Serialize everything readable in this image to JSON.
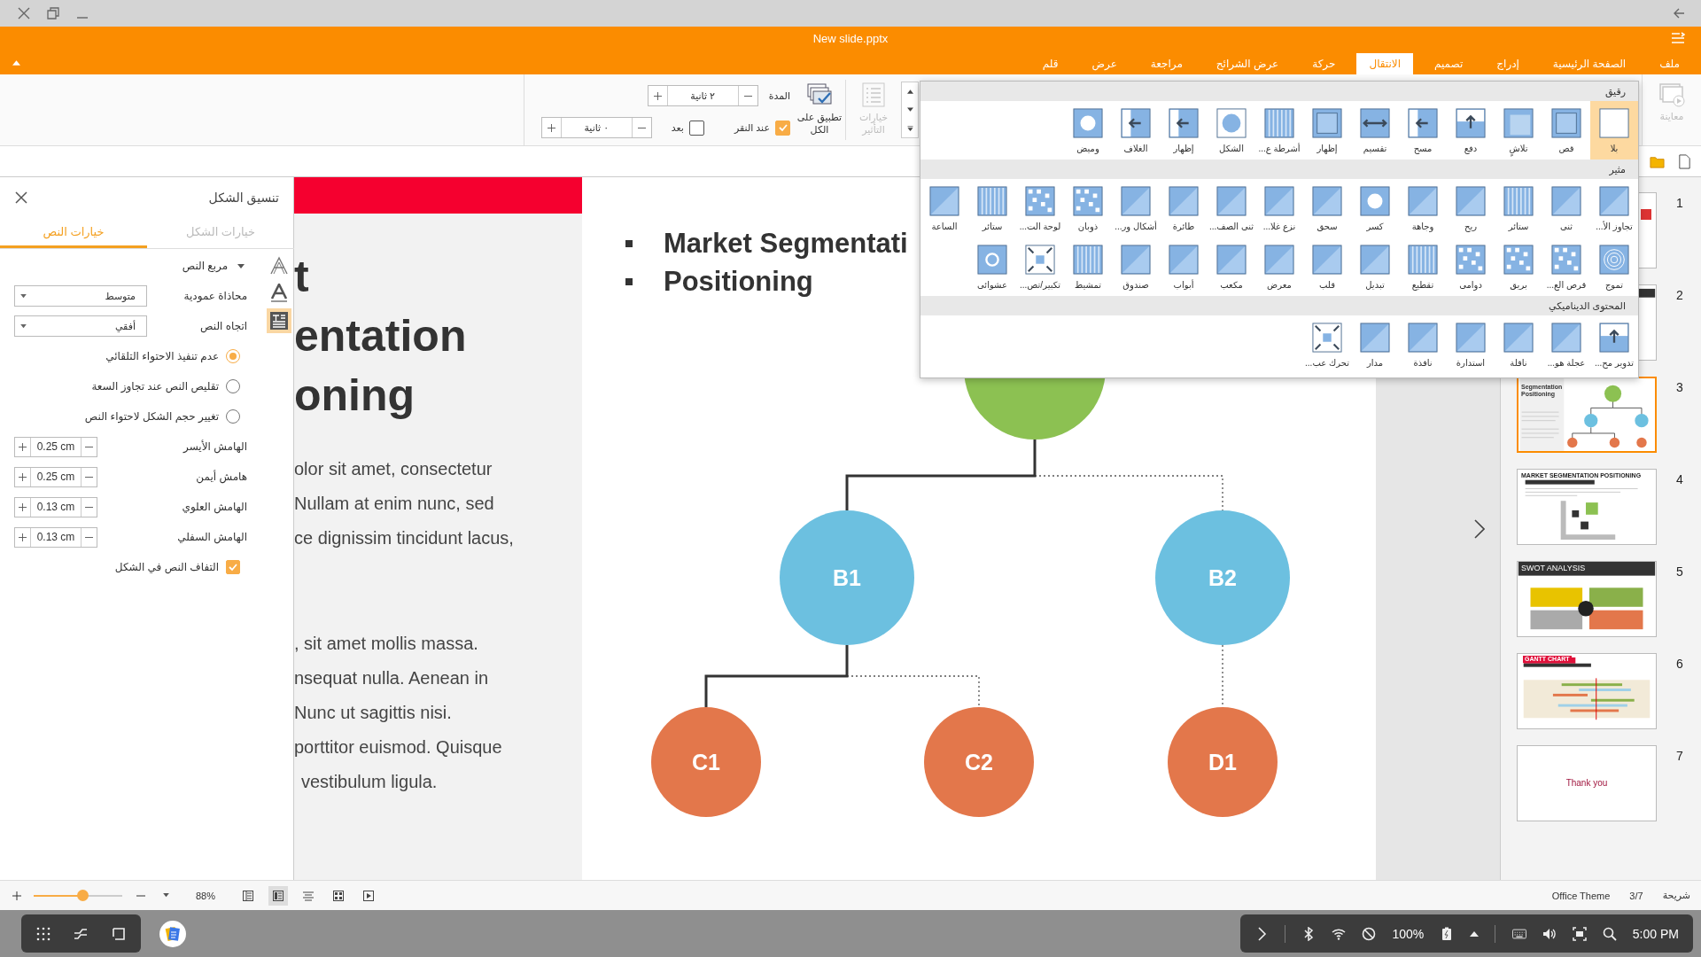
{
  "window": {
    "title": "New slide.pptx"
  },
  "menu_tabs": [
    {
      "label": "ملف",
      "selected": false
    },
    {
      "label": "الصفحة الرئيسية",
      "selected": false
    },
    {
      "label": "إدراج",
      "selected": false
    },
    {
      "label": "تصميم",
      "selected": false
    },
    {
      "label": "الانتقال",
      "selected": true
    },
    {
      "label": "حركة",
      "selected": false
    },
    {
      "label": "عرض الشرائح",
      "selected": false
    },
    {
      "label": "مراجعة",
      "selected": false
    },
    {
      "label": "عرض",
      "selected": false
    },
    {
      "label": "قلم",
      "selected": false
    }
  ],
  "ribbon": {
    "preview": {
      "label": "معاينة",
      "disabled": true
    },
    "effect_options": {
      "label": "خيارات التأثير",
      "disabled": true
    },
    "apply_all": {
      "label": "تطبيق على الكل"
    },
    "duration": {
      "label": "المدة",
      "value": "٢ ثانية"
    },
    "on_click": {
      "label": "عند النقر",
      "checked": true
    },
    "after": {
      "label": "بعد",
      "checked": false,
      "value": "٠ ثانية"
    }
  },
  "gallery": {
    "sections": [
      {
        "title": "رقيق",
        "items": [
          {
            "label": "بلا",
            "selected": true
          },
          {
            "label": "قص",
            "selected": false
          },
          {
            "label": "تلاشٍ",
            "selected": false
          },
          {
            "label": "دفع",
            "selected": false
          },
          {
            "label": "مسح",
            "selected": false
          },
          {
            "label": "تقسيم",
            "selected": false
          },
          {
            "label": "إظهار",
            "selected": false
          },
          {
            "label": "أشرطة ع...",
            "selected": false
          },
          {
            "label": "الشكل",
            "selected": false
          },
          {
            "label": "إظهار",
            "selected": false
          },
          {
            "label": "الغلاف",
            "selected": false
          },
          {
            "label": "وميض",
            "selected": false
          }
        ]
      },
      {
        "title": "مثير",
        "items": [
          {
            "label": "تجاوز الأ...",
            "selected": false
          },
          {
            "label": "ثنى",
            "selected": false
          },
          {
            "label": "ستائر",
            "selected": false
          },
          {
            "label": "ريح",
            "selected": false
          },
          {
            "label": "وجاهة",
            "selected": false
          },
          {
            "label": "كسر",
            "selected": false
          },
          {
            "label": "سحق",
            "selected": false
          },
          {
            "label": "نزع غلا...",
            "selected": false
          },
          {
            "label": "ثنى الصف...",
            "selected": false
          },
          {
            "label": "طائرة",
            "selected": false
          },
          {
            "label": "أشكال ور...",
            "selected": false
          },
          {
            "label": "ذوبان",
            "selected": false
          },
          {
            "label": "لوحة الت...",
            "selected": false
          },
          {
            "label": "ستائر",
            "selected": false
          },
          {
            "label": "الساعة",
            "selected": false
          },
          {
            "label": "تموج",
            "selected": false
          },
          {
            "label": "قرص الع...",
            "selected": false
          },
          {
            "label": "بريق",
            "selected": false
          },
          {
            "label": "دوامى",
            "selected": false
          },
          {
            "label": "تقطيع",
            "selected": false
          },
          {
            "label": "تبديل",
            "selected": false
          },
          {
            "label": "قلب",
            "selected": false
          },
          {
            "label": "معرض",
            "selected": false
          },
          {
            "label": "مكعب",
            "selected": false
          },
          {
            "label": "أبواب",
            "selected": false
          },
          {
            "label": "صندوق",
            "selected": false
          },
          {
            "label": "تمشيط",
            "selected": false
          },
          {
            "label": "تكبير/تص...",
            "selected": false
          },
          {
            "label": "عشوائى",
            "selected": false
          }
        ]
      },
      {
        "title": "المحتوى الديناميكي",
        "items": [
          {
            "label": "تدوير مح...",
            "selected": false
          },
          {
            "label": "عجلة هو...",
            "selected": false
          },
          {
            "label": "ناقلة",
            "selected": false
          },
          {
            "label": "استدارة",
            "selected": false
          },
          {
            "label": "نافذة",
            "selected": false
          },
          {
            "label": "مدار",
            "selected": false
          },
          {
            "label": "تحرك عب...",
            "selected": false
          }
        ]
      }
    ]
  },
  "format_panel": {
    "title": "تنسيق الشكل",
    "tabs": [
      {
        "label": "خيارات الشكل",
        "selected": false
      },
      {
        "label": "خيارات النص",
        "selected": true
      }
    ],
    "side_icons": [
      {
        "kind": "outline",
        "selected": false
      },
      {
        "kind": "fill",
        "selected": false
      },
      {
        "kind": "textbox",
        "selected": true
      }
    ],
    "section": {
      "label": "مربع النص",
      "expanded": true
    },
    "dropdowns": [
      {
        "label": "محاذاة عمودية",
        "value": "متوسط"
      },
      {
        "label": "اتجاه النص",
        "value": "أفقي"
      }
    ],
    "autofit": [
      {
        "label": "عدم تنفيذ الاحتواء التلقائي",
        "selected": true
      },
      {
        "label": "تقليص النص عند تجاوز السعة",
        "selected": false
      },
      {
        "label": "تغيير حجم الشكل لاحتواء النص",
        "selected": false
      }
    ],
    "margins": [
      {
        "label": "الهامش الأيسر",
        "value": "0.25 cm"
      },
      {
        "label": "هامش أيمن",
        "value": "0.25 cm"
      },
      {
        "label": "الهامش العلوي",
        "value": "0.13 cm"
      },
      {
        "label": "الهامش السفلي",
        "value": "0.13 cm"
      }
    ],
    "wrap": {
      "label": "التفاف النص في الشكل",
      "checked": true
    }
  },
  "slide": {
    "title_lines": [
      "t",
      "entation",
      "oning"
    ],
    "paragraphs": [
      [
        "olor sit amet, consectetur",
        "Nullam at enim nunc, sed",
        "ce dignissim tincidunt lacus,"
      ],
      [
        ", sit amet mollis massa.",
        "nsequat nulla. Aenean in",
        "Nunc ut sagittis nisi.",
        "porttitor euismod. Quisque",
        "vestibulum ligula."
      ]
    ],
    "bullets": [
      "Market Segmentati",
      "Positioning"
    ],
    "tree": {
      "color": "#8cc152",
      "children": [
        {
          "label": "B2",
          "color": "#6cc0e0",
          "children": [
            {
              "label": "D1",
              "color": "#e3774b"
            }
          ]
        },
        {
          "label": "B1",
          "color": "#6cc0e0",
          "children": [
            {
              "label": "C2",
              "color": "#e3774b"
            },
            {
              "label": "C1",
              "color": "#e3774b"
            }
          ]
        }
      ]
    }
  },
  "thumbnails": [
    {
      "number": "1",
      "kind": "title",
      "selected": false
    },
    {
      "number": "2",
      "kind": "header",
      "selected": false
    },
    {
      "number": "3",
      "kind": "tree",
      "title": "Segmentation Positioning",
      "selected": true
    },
    {
      "number": "4",
      "kind": "matrix",
      "title": "MARKET SEGMENTATION POSITIONING",
      "selected": false
    },
    {
      "number": "5",
      "kind": "swot",
      "title": "SWOT ANALYSIS",
      "selected": false
    },
    {
      "number": "6",
      "kind": "gantt",
      "title": "GANTT CHART",
      "selected": false
    },
    {
      "number": "7",
      "kind": "closing",
      "title": "Thank you",
      "selected": false
    }
  ],
  "status_bar": {
    "zoom": {
      "level": 0.55,
      "value": "88%"
    },
    "views": [
      {
        "kind": "normal",
        "selected": false
      },
      {
        "kind": "outline",
        "selected": true
      },
      {
        "kind": "notes",
        "selected": false
      },
      {
        "kind": "sorter",
        "selected": false
      },
      {
        "kind": "show",
        "selected": false
      }
    ],
    "slide_label": "شريحة",
    "slide_count": "3/7",
    "theme": "Office Theme"
  },
  "taskbar": {
    "battery": "100%",
    "time": "5:00 PM"
  }
}
